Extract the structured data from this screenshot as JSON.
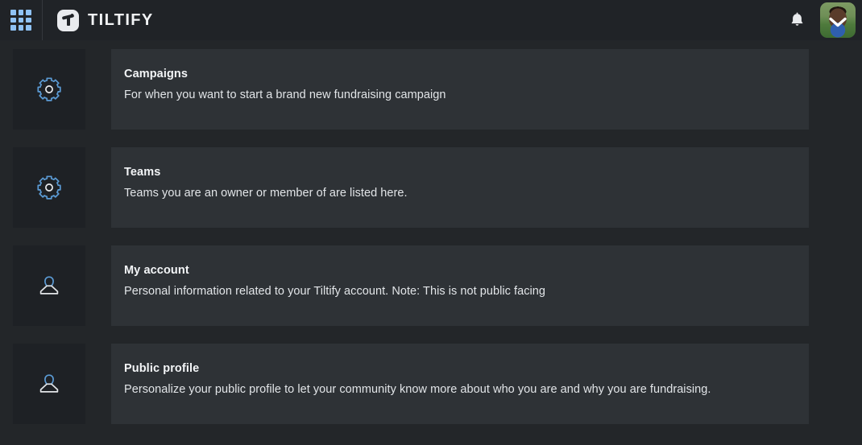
{
  "header": {
    "apps_grid_icon": "grid-apps-icon",
    "brand_name": "TILTIFY",
    "brand_logo_icon": "tiltify-logo-icon",
    "notifications_icon": "bell-icon",
    "avatar_icon": "user-avatar",
    "avatar_menu_icon": "chevron-down-icon"
  },
  "sections": [
    {
      "icon": "gear-icon",
      "title": "Campaigns",
      "description": "For when you want to start a brand new fundraising campaign"
    },
    {
      "icon": "gear-icon",
      "title": "Teams",
      "description": "Teams you are an owner or member of are listed here."
    },
    {
      "icon": "user-icon",
      "title": "My account",
      "description": "Personal information related to your Tiltify account. Note: This is not public facing"
    },
    {
      "icon": "user-icon",
      "title": "Public profile",
      "description": "Personalize your public profile to let your community know more about who you are and why you are fundraising."
    }
  ],
  "colors": {
    "page_background": "#232629",
    "header_background": "#202327",
    "card_background": "#2e3236",
    "icon_tile_background": "#1e2125",
    "accent_blue": "#5b9bd5",
    "grid_icon_blue": "#8fc2f5",
    "text_primary": "#f3f5f7"
  }
}
